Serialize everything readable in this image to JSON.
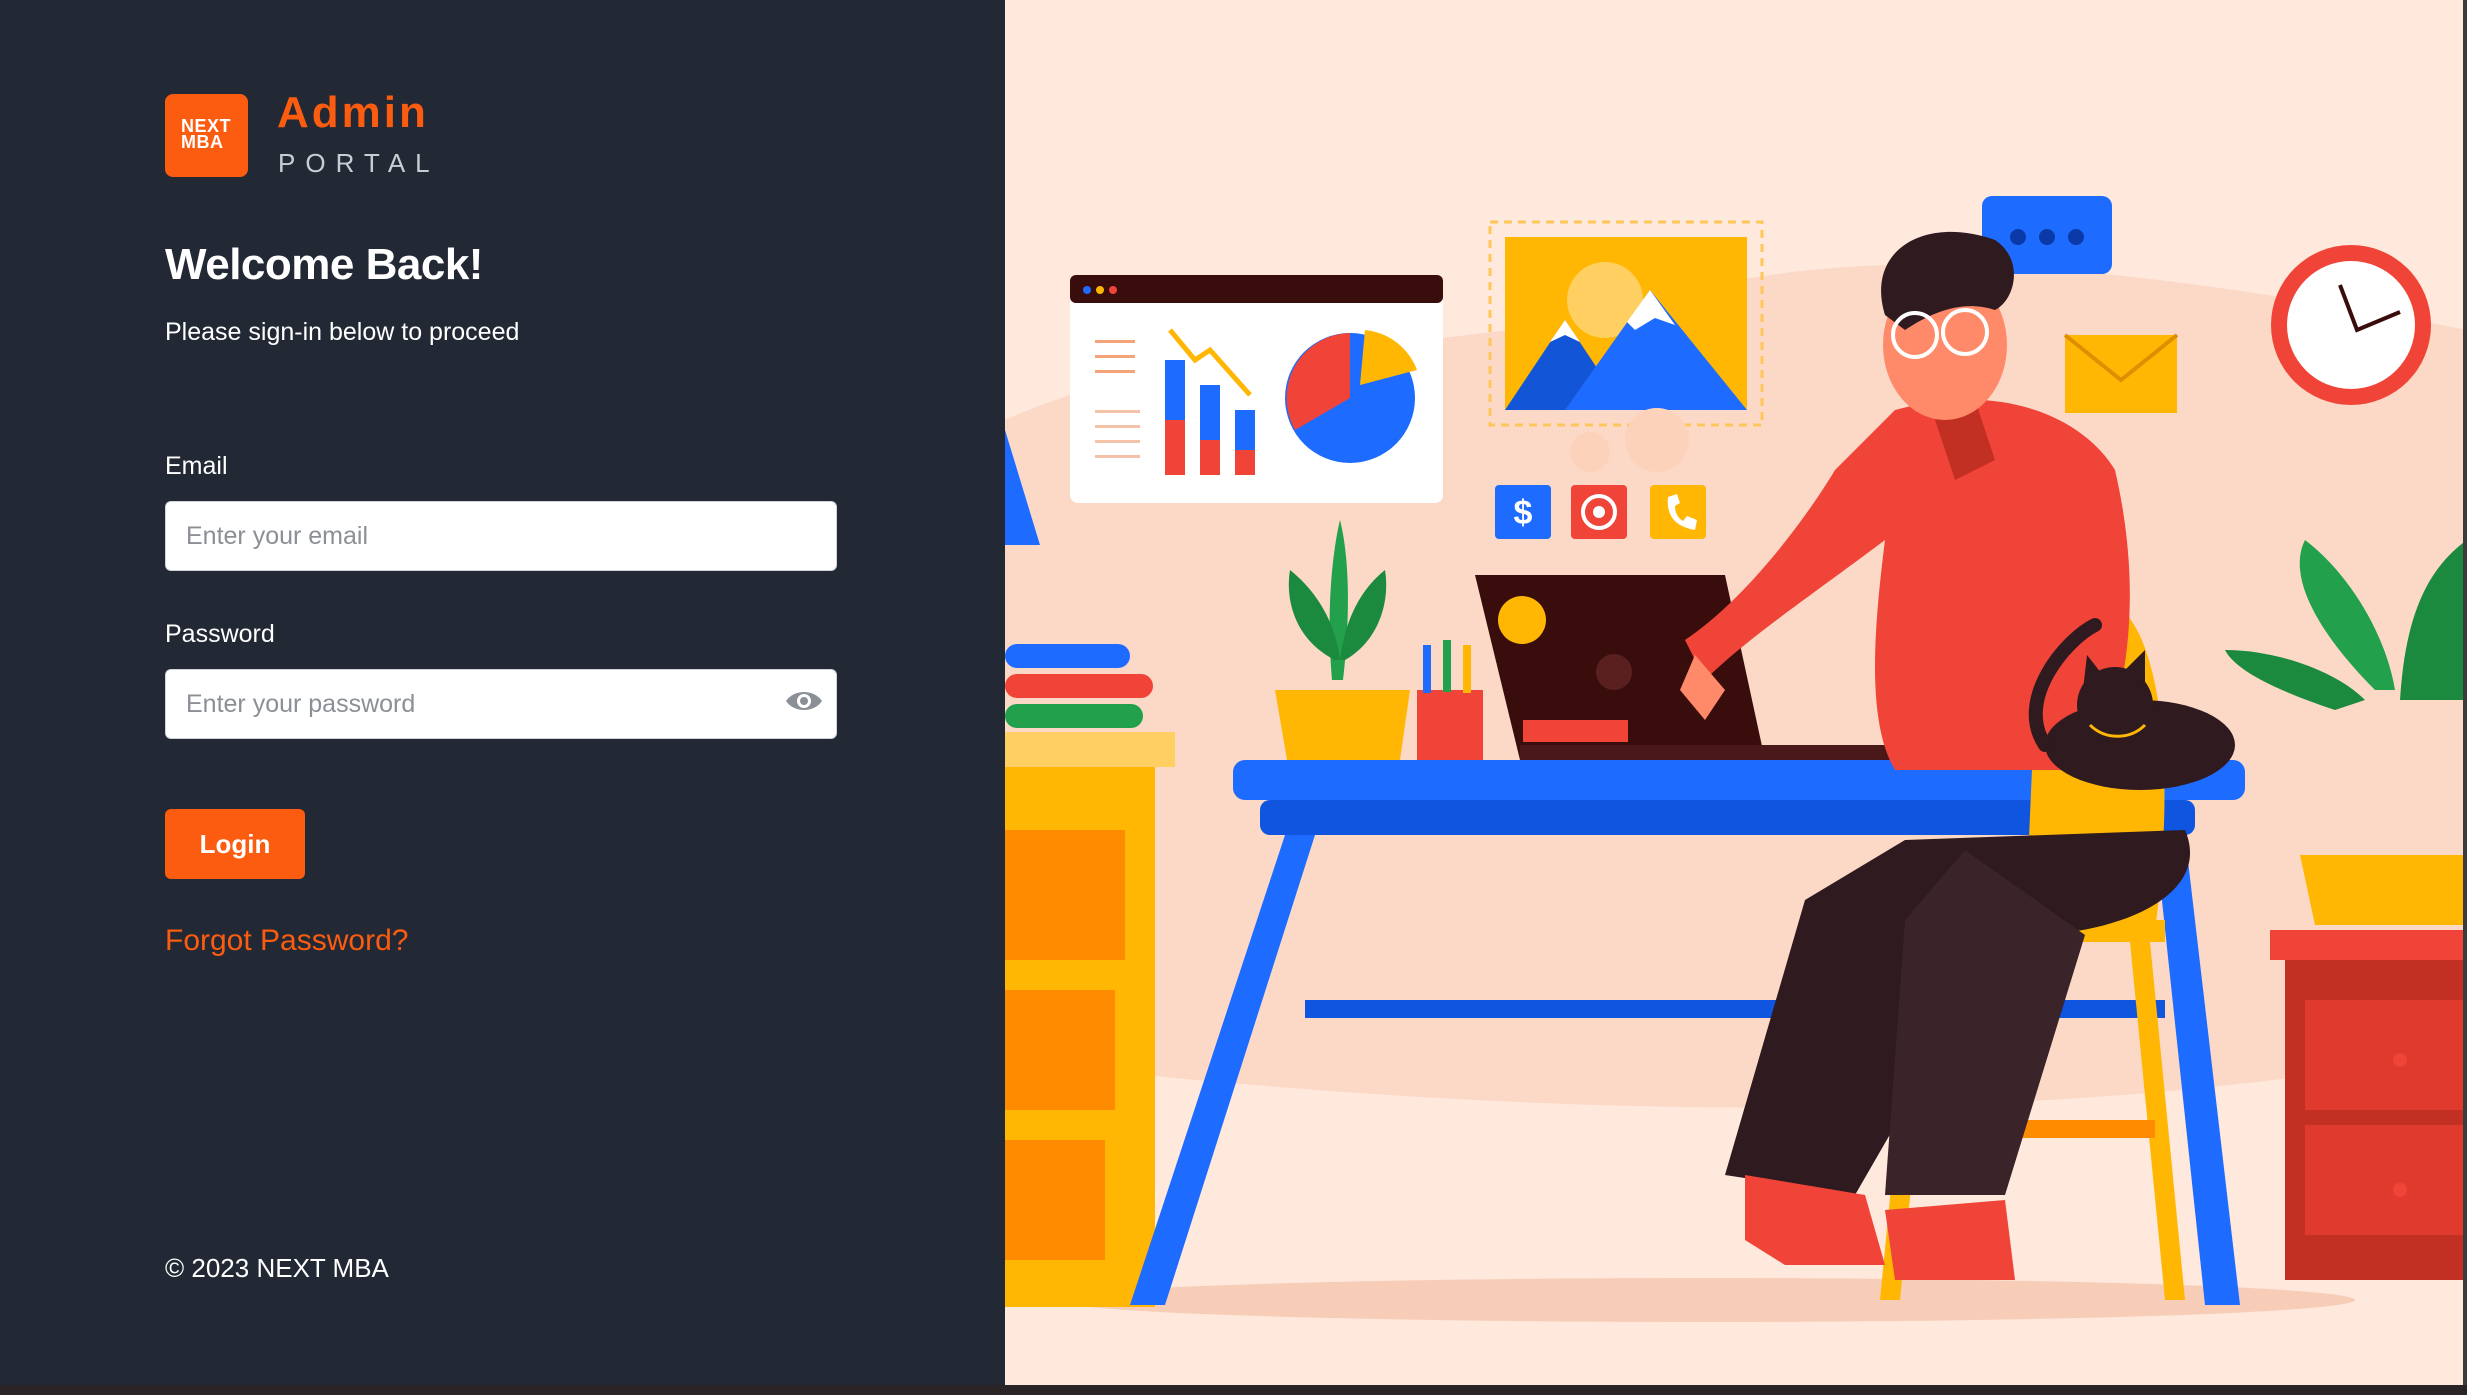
{
  "logo": {
    "line1": "NEXT",
    "line2": "MBA",
    "title": "Admin",
    "subtitle": "PORTAL"
  },
  "form": {
    "heading": "Welcome Back!",
    "subheading": "Please sign-in below to proceed",
    "email_label": "Email",
    "email_placeholder": "Enter your email",
    "password_label": "Password",
    "password_placeholder": "Enter your password",
    "login_label": "Login",
    "forgot_label": "Forgot Password?"
  },
  "footer": {
    "copyright": "© 2023 NEXT MBA"
  },
  "colors": {
    "accent": "#fb5c0f",
    "panel_bg": "#222834",
    "illustration_bg": "#ffe8dc"
  },
  "icons": {
    "password_toggle": "eye-icon"
  },
  "illustration": {
    "description_icons": [
      "chart-icon",
      "image-icon",
      "chat-icon",
      "clock-icon",
      "mail-icon",
      "dollar-icon",
      "phone-icon"
    ]
  }
}
